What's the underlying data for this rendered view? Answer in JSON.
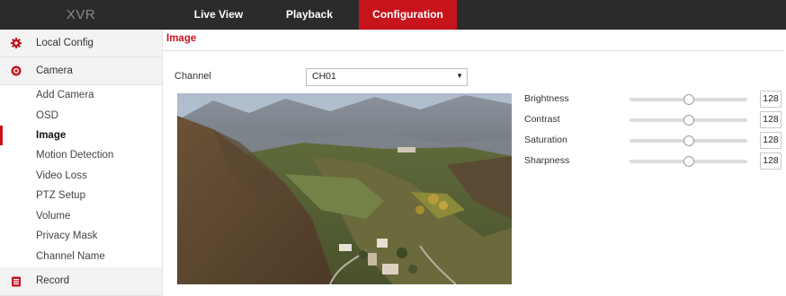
{
  "header": {
    "logo": "XVR",
    "nav": [
      {
        "label": "Live View",
        "active": false
      },
      {
        "label": "Playback",
        "active": false
      },
      {
        "label": "Configuration",
        "active": true
      }
    ]
  },
  "sidebar": {
    "categories": [
      {
        "label": "Local Config",
        "icon": "gear-icon"
      },
      {
        "label": "Camera",
        "icon": "camera-icon"
      },
      {
        "label": "Record",
        "icon": "record-icon"
      }
    ],
    "camera_items": [
      {
        "label": "Add Camera"
      },
      {
        "label": "OSD"
      },
      {
        "label": "Image",
        "active": true
      },
      {
        "label": "Motion Detection"
      },
      {
        "label": "Video Loss"
      },
      {
        "label": "PTZ Setup"
      },
      {
        "label": "Volume"
      },
      {
        "label": "Privacy Mask"
      },
      {
        "label": "Channel Name"
      }
    ]
  },
  "main": {
    "tab": "Image",
    "channel_label": "Channel",
    "channel_value": "CH01",
    "params": [
      {
        "label": "Brightness",
        "value": "128",
        "fraction": 0.5
      },
      {
        "label": "Contrast",
        "value": "128",
        "fraction": 0.5
      },
      {
        "label": "Saturation",
        "value": "128",
        "fraction": 0.5
      },
      {
        "label": "Sharpness",
        "value": "128",
        "fraction": 0.5
      }
    ]
  },
  "colors": {
    "accent": "#c7141c",
    "topbar": "#2b2b2b"
  }
}
